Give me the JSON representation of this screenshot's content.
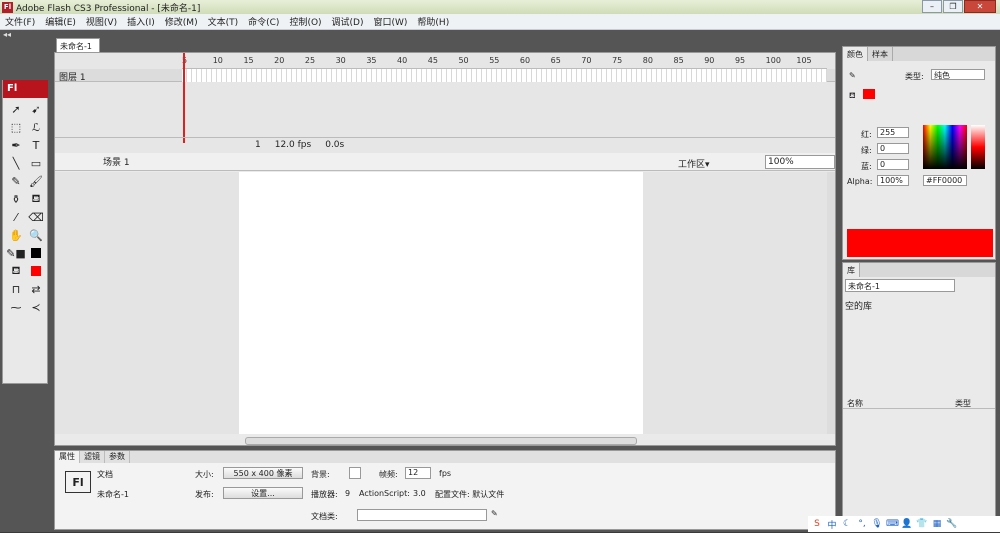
{
  "window": {
    "title": "Adobe Flash CS3 Professional - [未命名-1]",
    "app_icon": "Fl"
  },
  "menu": [
    "文件(F)",
    "编辑(E)",
    "视图(V)",
    "插入(I)",
    "修改(M)",
    "文本(T)",
    "命令(C)",
    "控制(O)",
    "调试(D)",
    "窗口(W)",
    "帮助(H)"
  ],
  "tools": {
    "logo": "Fl"
  },
  "document": {
    "tab": "未命名-1"
  },
  "timeline": {
    "frame_labels": [
      "5",
      "10",
      "15",
      "20",
      "25",
      "30",
      "35",
      "40",
      "45",
      "50",
      "55",
      "60",
      "65",
      "70",
      "75",
      "80",
      "85",
      "90",
      "95",
      "100",
      "105"
    ],
    "layer": "图层 1",
    "current_frame": "1",
    "fps": "12.0 fps",
    "time": "0.0s"
  },
  "editbar": {
    "scene": "场景 1",
    "workspace": "工作区▾",
    "zoom": "100%"
  },
  "properties": {
    "tabs": [
      "属性",
      "滤镜",
      "参数"
    ],
    "doc_icon": "Fl",
    "doc_label": "文档",
    "doc_name": "未命名-1",
    "size_label": "大小:",
    "size_value": "550 x 400 像素",
    "bg_label": "背景:",
    "fps_label": "帧频:",
    "fps_value": "12",
    "fps_unit": "fps",
    "publish_label": "发布:",
    "settings_button": "设置...",
    "player_label": "播放器:",
    "player_value": "9",
    "as_label": "ActionScript:",
    "as_value": "3.0",
    "profile": "配置文件: 默认文件",
    "class_label": "文档类:"
  },
  "color_panel": {
    "tabs": [
      "颜色",
      "样本"
    ],
    "type_label": "类型:",
    "type_value": "纯色",
    "red_label": "红:",
    "red": "255",
    "green_label": "绿:",
    "green": "0",
    "blue_label": "蓝:",
    "blue": "0",
    "alpha_label": "Alpha:",
    "alpha": "100%",
    "hex": "#FF0000",
    "fill_color": "#FF0000"
  },
  "library": {
    "tab": "库",
    "doc": "未命名-1",
    "empty": "空的库",
    "col_name": "名称",
    "col_type": "类型"
  }
}
